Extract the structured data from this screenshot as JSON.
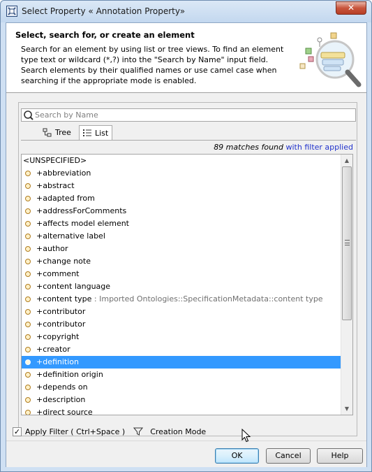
{
  "window": {
    "title": "Select Property « Annotation Property»",
    "close_label": "✕"
  },
  "header": {
    "title": "Select, search for, or create an element",
    "description": "Search for an element by using list or tree views. To find an element type text or wildcard (*,?) into the \"Search by Name\" input field. Search elements by their qualified names or use camel case when searching if the appropriate mode is enabled."
  },
  "search": {
    "placeholder": "Search by Name",
    "value": ""
  },
  "tabs": {
    "tree_label": "Tree",
    "list_label": "List",
    "active": "List"
  },
  "matches": {
    "count_text": "89 matches found",
    "filter_text": "with filter applied"
  },
  "list": {
    "unspecified": "<UNSPECIFIED>",
    "items": [
      {
        "label": "+abbreviation",
        "extra": ""
      },
      {
        "label": "+abstract",
        "extra": ""
      },
      {
        "label": "+adapted from",
        "extra": ""
      },
      {
        "label": "+addressForComments",
        "extra": ""
      },
      {
        "label": "+affects model element",
        "extra": ""
      },
      {
        "label": "+alternative label",
        "extra": ""
      },
      {
        "label": "+author",
        "extra": ""
      },
      {
        "label": "+change note",
        "extra": ""
      },
      {
        "label": "+comment",
        "extra": ""
      },
      {
        "label": "+content language",
        "extra": ""
      },
      {
        "label": "+content type",
        "extra": " : Imported Ontologies::SpecificationMetadata::content type"
      },
      {
        "label": "+contributor",
        "extra": ""
      },
      {
        "label": "+contributor",
        "extra": ""
      },
      {
        "label": "+copyright",
        "extra": ""
      },
      {
        "label": "+creator",
        "extra": ""
      },
      {
        "label": "+definition",
        "extra": ""
      },
      {
        "label": "+definition origin",
        "extra": ""
      },
      {
        "label": "+depends on",
        "extra": ""
      },
      {
        "label": "+description",
        "extra": ""
      },
      {
        "label": "+direct source",
        "extra": ""
      }
    ],
    "selected_index": 15
  },
  "filter": {
    "apply_label": "Apply Filter ( Ctrl+Space )",
    "apply_checked": true,
    "creation_mode_label": "Creation Mode"
  },
  "buttons": {
    "ok": "OK",
    "cancel": "Cancel",
    "help": "Help"
  },
  "colors": {
    "selection": "#3399ff",
    "filter_link": "#2233cc",
    "close": "#c8553c"
  }
}
